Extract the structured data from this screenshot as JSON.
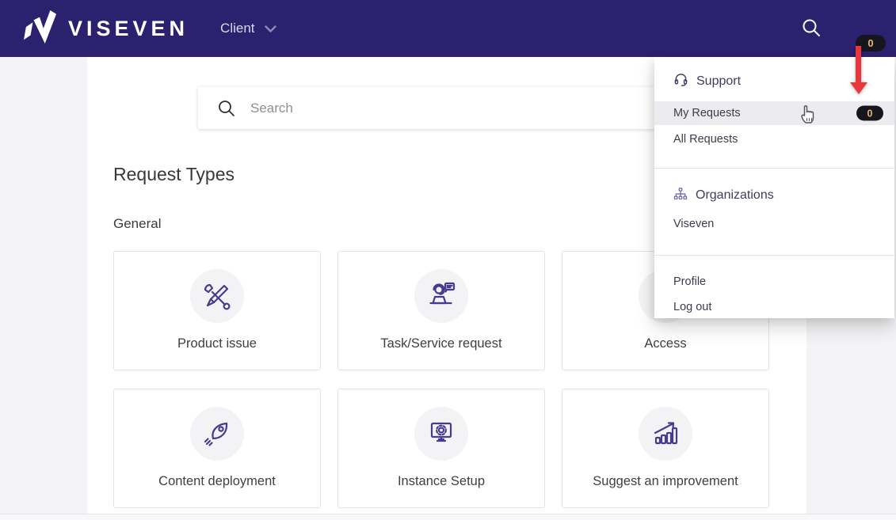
{
  "header": {
    "brand": "VISEVEN",
    "client_menu_label": "Client",
    "avatar_badge_count": "0"
  },
  "search": {
    "placeholder": "Search"
  },
  "page": {
    "title": "Request Types",
    "section_title": "General"
  },
  "cards": [
    {
      "label": "Product issue",
      "icon": "tools-icon"
    },
    {
      "label": "Task/Service request",
      "icon": "support-agent-icon"
    },
    {
      "label": "Access",
      "icon": "lock-icon"
    },
    {
      "label": "Content deployment",
      "icon": "rocket-icon"
    },
    {
      "label": "Instance Setup",
      "icon": "monitor-gear-icon"
    },
    {
      "label": "Suggest an improvement",
      "icon": "growth-chart-icon"
    }
  ],
  "user_menu": {
    "support_header": "Support",
    "items": [
      {
        "label": "My Requests",
        "badge": "0"
      },
      {
        "label": "All Requests"
      }
    ],
    "organizations_header": "Organizations",
    "organizations": [
      {
        "label": "Viseven"
      }
    ],
    "account": [
      {
        "label": "Profile"
      },
      {
        "label": "Log out"
      }
    ]
  },
  "colors": {
    "header_bg": "#2b216e",
    "accent_purple": "#4a3a8f",
    "arrow_red": "#e8383e",
    "badge_bg": "#17161f",
    "badge_text": "#e3ba62",
    "highlight_row": "#ececf0"
  }
}
